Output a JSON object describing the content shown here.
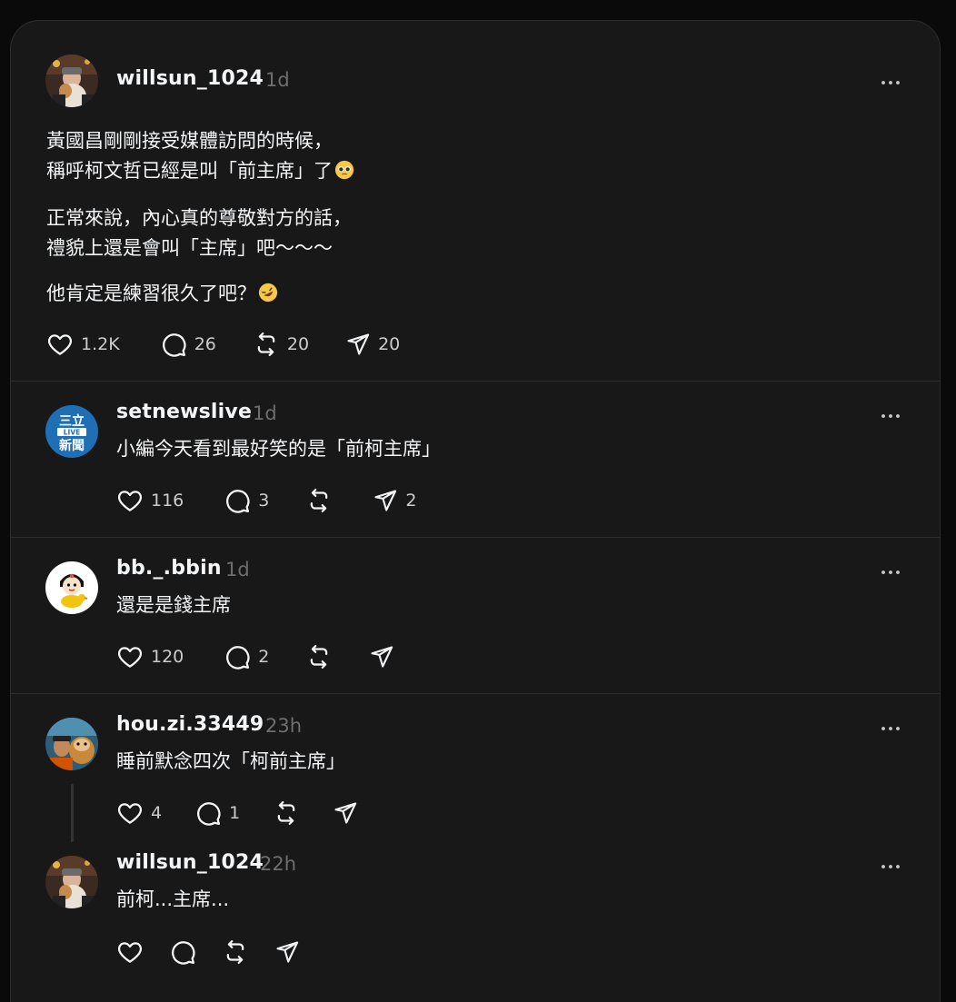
{
  "posts": [
    {
      "username": "willsun_1024",
      "time": "1d",
      "lines": [
        "黃國昌剛剛接受媒體訪問的時候，",
        "稱呼柯文哲已經是叫「前主席」了",
        "正常來說，內心真的尊敬對方的話，",
        "禮貌上還是會叫「主席」吧～～～",
        "他肯定是練習很久了吧？"
      ],
      "emoji_1": "pleading-face-emoji",
      "emoji_2": "rolling-on-floor-laughing-emoji",
      "likes": "1.2K",
      "replies": "26",
      "reposts": "20",
      "shares": "20"
    },
    {
      "username": "setnewslive",
      "time": "1d",
      "text": "小編今天看到最好笑的是「前柯主席」",
      "avatar_text": [
        "三立",
        "LIVE",
        "新聞"
      ],
      "likes": "116",
      "replies": "3",
      "reposts": "",
      "shares": "2"
    },
    {
      "username": "bb._.bbin",
      "time": "1d",
      "text": "還是是錢主席",
      "likes": "120",
      "replies": "2",
      "reposts": "",
      "shares": ""
    },
    {
      "username": "hou.zi.33449",
      "time": "23h",
      "text": "睡前默念四次「柯前主席」",
      "likes": "4",
      "replies": "1",
      "reposts": "",
      "shares": ""
    },
    {
      "username": "willsun_1024",
      "time": "22h",
      "text": "前柯...主席...",
      "likes": "",
      "replies": "",
      "reposts": "",
      "shares": ""
    }
  ],
  "icons": {
    "like": "heart-icon",
    "reply": "comment-icon",
    "repost": "repost-icon",
    "share": "send-icon",
    "more": "more-dots-icon"
  },
  "colors": {
    "background": "#0a0a0a",
    "card": "#181818",
    "text": "#f3f5f7",
    "muted": "#6e6e6e",
    "divider": "#2d2d2d",
    "setn_blue": "#1f6fb5"
  }
}
